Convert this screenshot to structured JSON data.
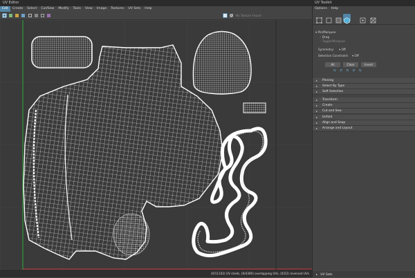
{
  "editor": {
    "title": "UV Editor",
    "menus": [
      "Edit",
      "Create",
      "Select",
      "Cut/Sew",
      "Modify",
      "Tools",
      "View",
      "Image",
      "Textures",
      "UV Sets",
      "Help"
    ],
    "texture_dropdown": "No Texture Found",
    "status": "(0/11102) UV shells, (0/4300) overlapping UVs, (0/22) reversed UVs"
  },
  "toolkit": {
    "title": "UV Toolkit",
    "menus": [
      "Options",
      "Help"
    ],
    "pin_marquee": {
      "header": "Pin/Marquee",
      "drag": "Drag",
      "toggle": "Toggle/Marquee"
    },
    "symmetry_label": "Symmetry:",
    "symmetry_value": "Off",
    "selection_constraint_label": "Selection Constraint:",
    "selection_constraint_value": "Off",
    "buttons": {
      "all": "All",
      "clear": "Clear",
      "invert": "Invert"
    },
    "sections": [
      "Pinning",
      "Select By Type",
      "Soft Selection",
      "Transform",
      "Create",
      "Cut and Sew",
      "Unfold",
      "Align and Snap",
      "Arrange and Layout"
    ],
    "footer": "UV Sets"
  },
  "colors": {
    "accent": "#5285a6",
    "uv_wire": "#ffffff",
    "axis_u": "#c93a3a",
    "axis_v": "#2fae3a",
    "cube_icon": "#56b3d8"
  }
}
